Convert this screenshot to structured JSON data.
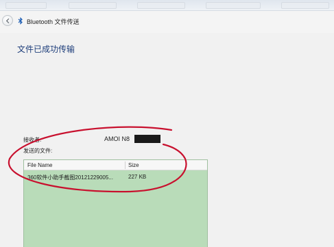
{
  "window": {
    "title": "Bluetooth 文件传送",
    "heading": "文件已成功传输"
  },
  "details": {
    "receiver_label": "接收者:",
    "receiver_value": "AMOI N8",
    "files_label": "发送的文件:"
  },
  "table": {
    "columns": [
      "File Name",
      "Size"
    ],
    "rows": [
      {
        "name": "360软件小助手截图20121229005...",
        "size": "227 KB"
      }
    ]
  },
  "colors": {
    "heading": "#1d3d7a",
    "table_bg": "#b9dcb9",
    "annotation_ellipse": "#c8102e"
  },
  "icons": [
    "back-arrow-icon",
    "bluetooth-icon"
  ]
}
